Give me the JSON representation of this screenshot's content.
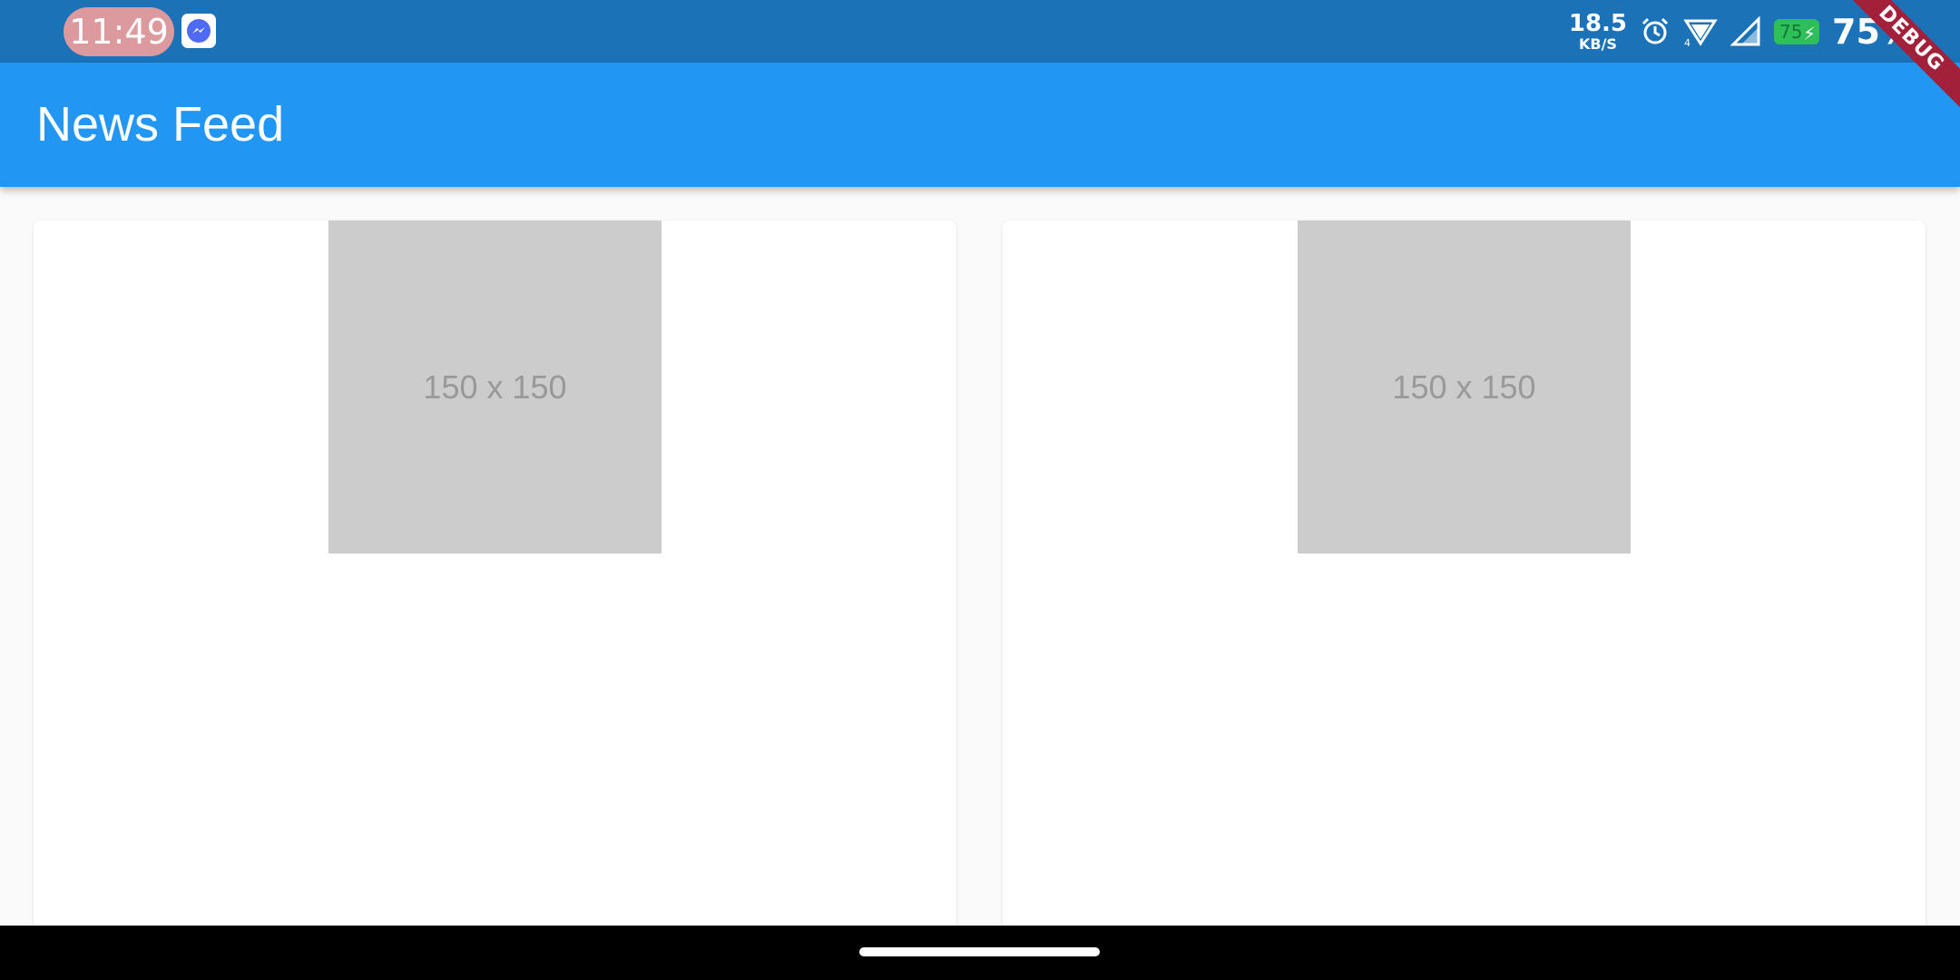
{
  "status_bar": {
    "time": "11:49",
    "net_speed_value": "18.5",
    "net_speed_unit": "KB/S",
    "signal_badge": "4",
    "battery_level": "75",
    "battery_percent": "75%"
  },
  "debug_banner": "DEBUG",
  "app_bar": {
    "title": "News Feed"
  },
  "feed": {
    "cards": [
      {
        "image_label": "150 x 150"
      },
      {
        "image_label": "150 x 150"
      }
    ]
  },
  "colors": {
    "status_bar_bg": "#1b72b7",
    "app_bar_bg": "#2196f3",
    "placeholder_bg": "#cccccc",
    "debug_banner_bg": "#a3203a",
    "battery": "#2fbf5a"
  },
  "icons": [
    "messenger-icon",
    "alarm-icon",
    "wifi-icon",
    "cell-signal-icon",
    "battery-icon",
    "charging-bolt-icon"
  ]
}
